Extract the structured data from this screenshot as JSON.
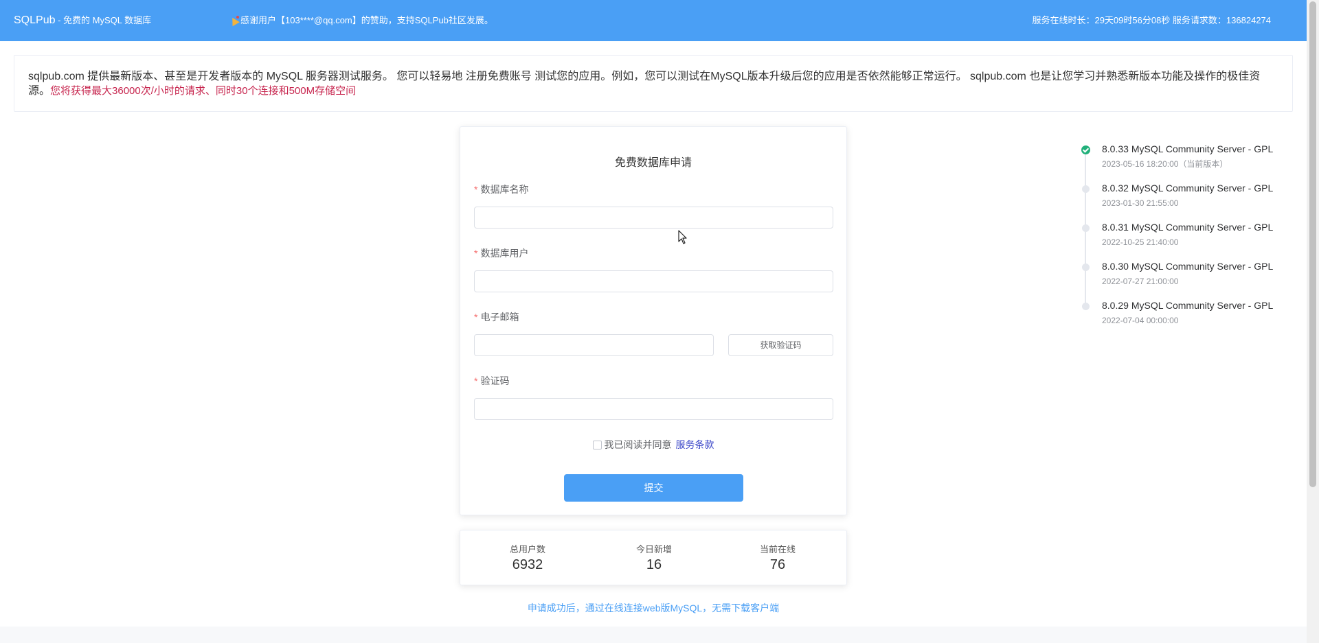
{
  "header": {
    "brand": "SQLPub",
    "brand_sub": " - 免费的 MySQL 数据库",
    "thanks": "感谢用户【103****@qq.com】的赞助，支持SQLPub社区发展。",
    "uptime": "服务在线时长：29天09时56分08秒 服务请求数：136824274",
    "background_color": "#4a9ff5"
  },
  "intro": {
    "text": "sqlpub.com 提供最新版本、甚至是开发者版本的 MySQL 服务器测试服务。 您可以轻易地 注册免费账号 测试您的应用。例如，您可以测试在MySQL版本升级后您的应用是否依然能够正常运行。 sqlpub.com 也是让您学习并熟悉新版本功能及操作的极佳资源。",
    "highlight": "您将获得最大36000次/小时的请求、同时30个连接和500M存储空间",
    "highlight_color": "#c7254e"
  },
  "form": {
    "title": "免费数据库申请",
    "required_mark": "*",
    "db_name_label": "数据库名称",
    "db_name_value": "",
    "db_user_label": "数据库用户",
    "db_user_value": "",
    "email_label": "电子邮箱",
    "email_value": "",
    "get_code_label": "获取验证码",
    "code_label": "验证码",
    "code_value": "",
    "agree_text": "我已阅读并同意",
    "terms_link": "服务条款",
    "submit_label": "提交",
    "submit_color": "#4a9ff5"
  },
  "stats": [
    {
      "label": "总用户数",
      "value": "6932"
    },
    {
      "label": "今日新增",
      "value": "16"
    },
    {
      "label": "当前在线",
      "value": "76"
    }
  ],
  "note": "申请成功后，通过在线连接web版MySQL，无需下载客户端",
  "timeline": [
    {
      "title": "8.0.33 MySQL Community Server - GPL",
      "date": "2023-05-16 18:20:00（当前版本）",
      "active": true
    },
    {
      "title": "8.0.32 MySQL Community Server - GPL",
      "date": "2023-01-30 21:55:00",
      "active": false
    },
    {
      "title": "8.0.31 MySQL Community Server - GPL",
      "date": "2022-10-25 21:40:00",
      "active": false
    },
    {
      "title": "8.0.30 MySQL Community Server - GPL",
      "date": "2022-07-27 21:00:00",
      "active": false
    },
    {
      "title": "8.0.29 MySQL Community Server - GPL",
      "date": "2022-07-04 00:00:00",
      "active": false
    }
  ],
  "timeline_active_color": "#21b07a"
}
